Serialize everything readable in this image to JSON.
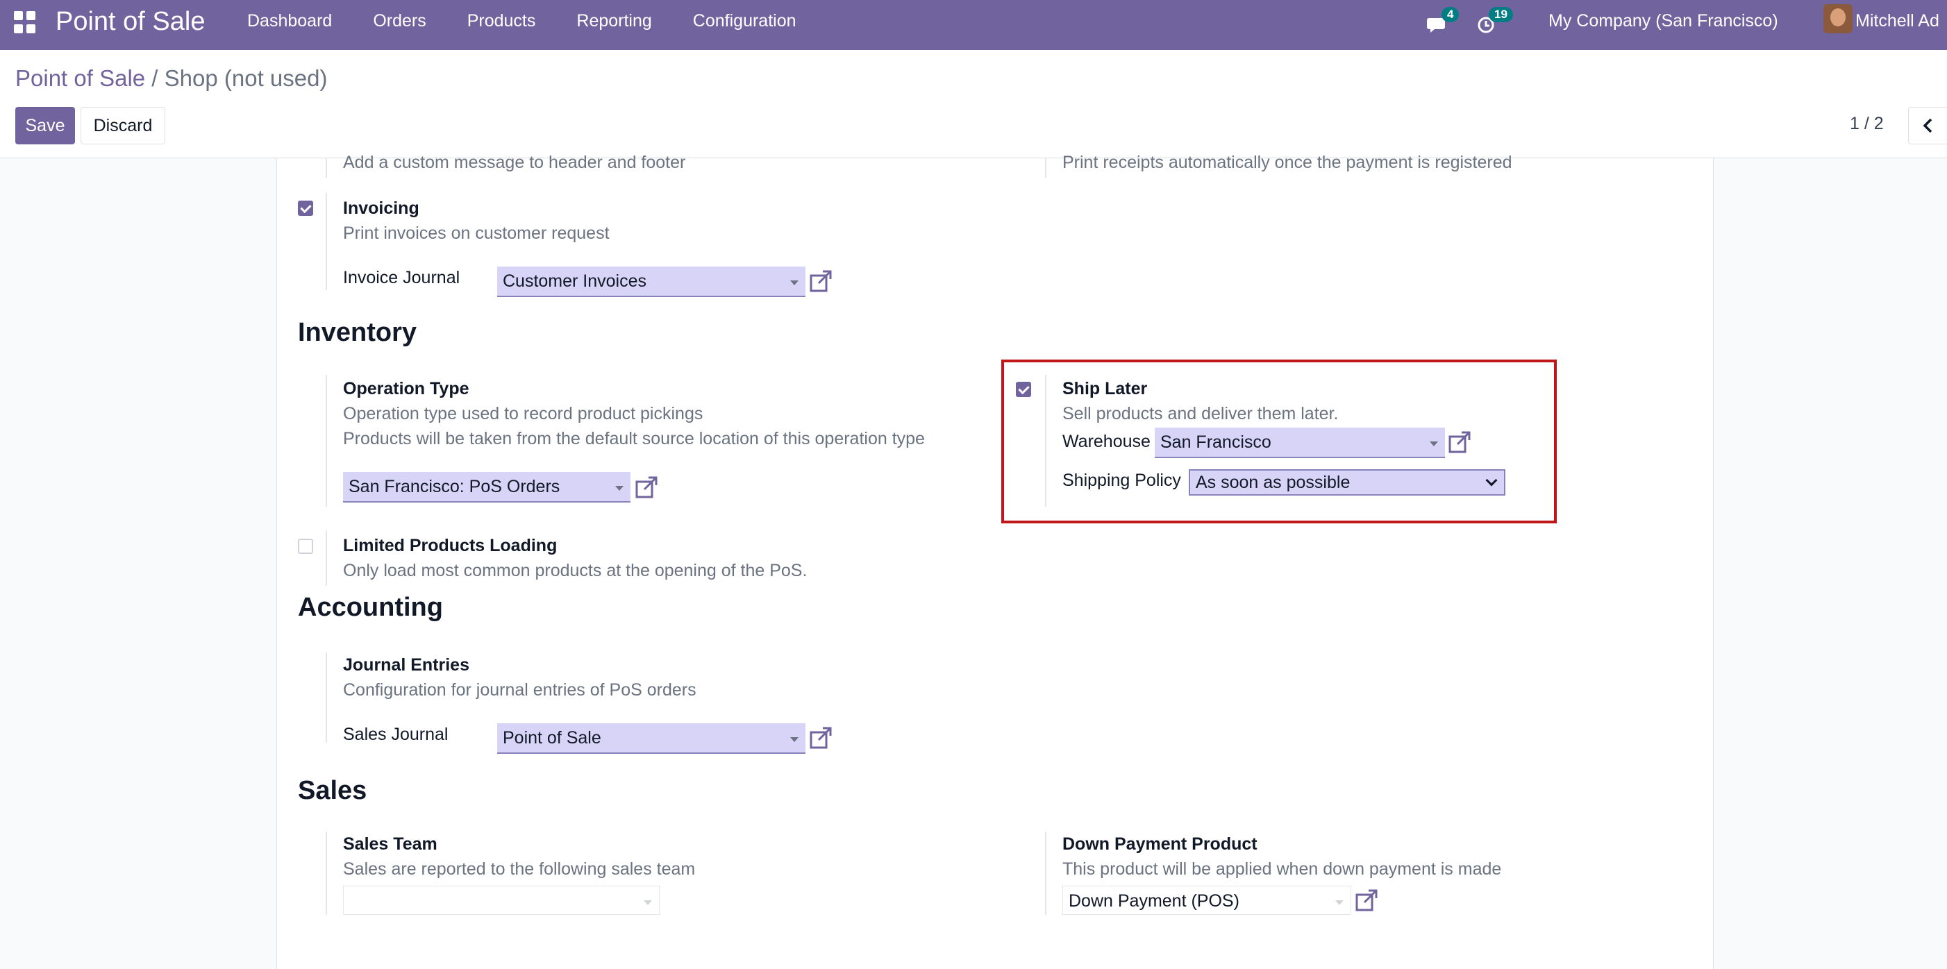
{
  "navbar": {
    "app_name": "Point of Sale",
    "menu": [
      "Dashboard",
      "Orders",
      "Products",
      "Reporting",
      "Configuration"
    ],
    "chat_count": "4",
    "activity_count": "19",
    "company": "My Company (San Francisco)",
    "user": "Mitchell Ad"
  },
  "control": {
    "breadcrumb_parent": "Point of Sale",
    "breadcrumb_sep": "/",
    "breadcrumb_current": "Shop (not used)",
    "save_label": "Save",
    "discard_label": "Discard",
    "pager": "1 / 2"
  },
  "form": {
    "header_footer_desc": "Add a custom message to header and footer",
    "auto_print_desc": "Print receipts automatically once the payment is registered",
    "invoicing": {
      "title": "Invoicing",
      "desc": "Print invoices on customer request",
      "journal_label": "Invoice Journal",
      "journal_value": "Customer Invoices",
      "checked": true
    },
    "inventory": {
      "heading": "Inventory",
      "operation_type": {
        "title": "Operation Type",
        "desc1": "Operation type used to record product pickings",
        "desc2": "Products will be taken from the default source location of this operation type",
        "value": "San Francisco: PoS Orders"
      },
      "ship_later": {
        "title": "Ship Later",
        "desc": "Sell products and deliver them later.",
        "warehouse_label": "Warehouse",
        "warehouse_value": "San Francisco",
        "policy_label": "Shipping Policy",
        "policy_value": "As soon as possible",
        "checked": true
      },
      "limited_loading": {
        "title": "Limited Products Loading",
        "desc": "Only load most common products at the opening of the PoS.",
        "checked": false
      }
    },
    "accounting": {
      "heading": "Accounting",
      "journal_entries": {
        "title": "Journal Entries",
        "desc": "Configuration for journal entries of PoS orders",
        "sales_journal_label": "Sales Journal",
        "sales_journal_value": "Point of Sale"
      }
    },
    "sales": {
      "heading": "Sales",
      "sales_team": {
        "title": "Sales Team",
        "desc": "Sales are reported to the following sales team",
        "value": ""
      },
      "down_payment": {
        "title": "Down Payment Product",
        "desc": "This product will be applied when down payment is made",
        "value": "Down Payment (POS)"
      }
    }
  },
  "colors": {
    "brand": "#71639e",
    "highlight": "#c0151b",
    "badge": "#017e84"
  }
}
